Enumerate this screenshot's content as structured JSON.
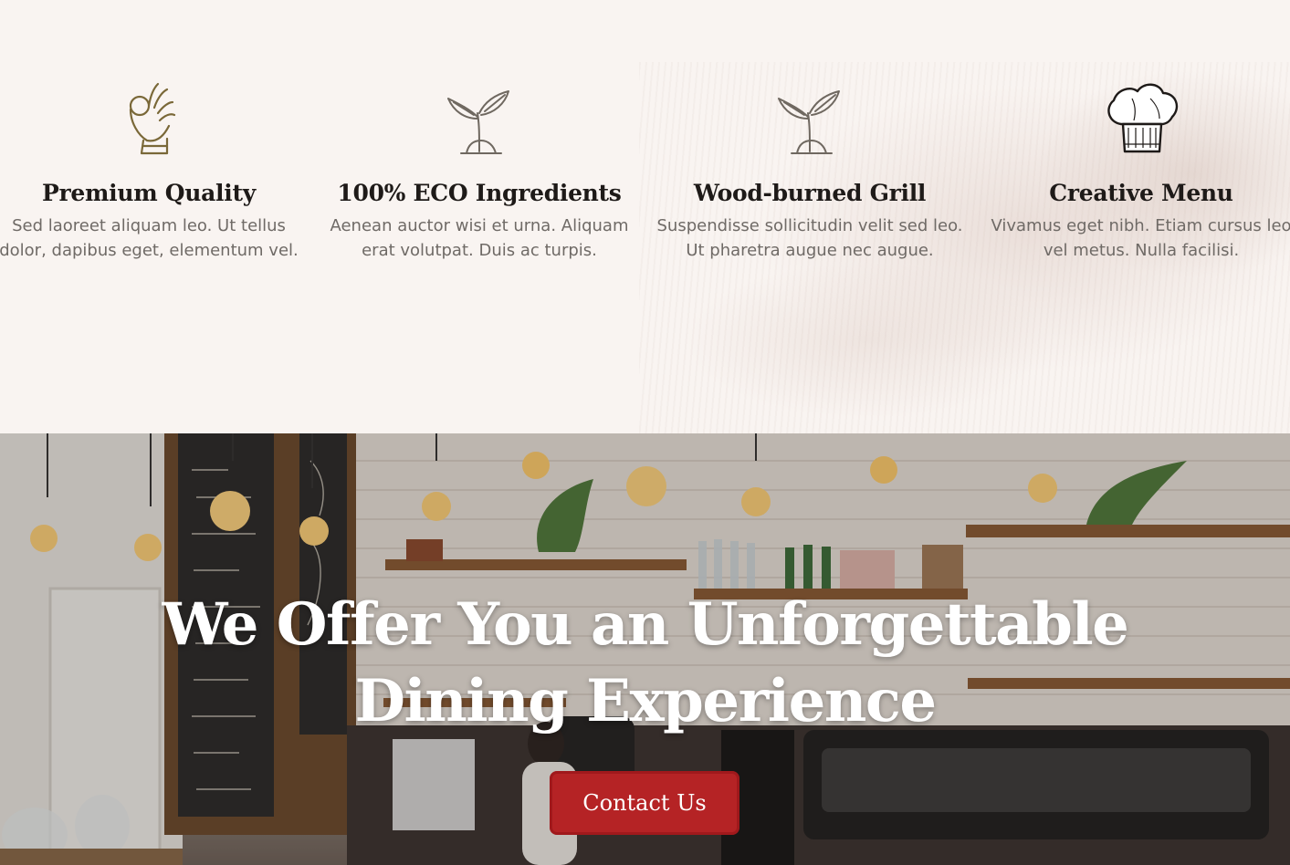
{
  "features": [
    {
      "icon": "ok-hand-icon",
      "title": "Premium Quality",
      "text": "Sed laoreet aliquam leo. Ut tellus dolor, dapibus eget, elementum vel."
    },
    {
      "icon": "sprout-icon",
      "title": "100% ECO Ingredients",
      "text": "Aenean auctor wisi et urna. Aliquam erat volutpat. Duis ac turpis."
    },
    {
      "icon": "sprout-icon",
      "title": "Wood-burned Grill",
      "text": "Suspendisse sollicitudin velit sed leo. Ut pharetra augue nec augue."
    },
    {
      "icon": "chef-hat-icon",
      "title": "Creative Menu",
      "text": "Vivamus eget nibh. Etiam cursus leo vel metus. Nulla facilisi."
    }
  ],
  "hero": {
    "heading": "We Offer You an Unforgettable Dining Experience",
    "cta_label": "Contact Us",
    "background": "cafe-interior-photo"
  },
  "colors": {
    "page_background": "#f9f4f1",
    "heading_text": "#1e1a18",
    "body_text": "#6f6a66",
    "icon_olive": "#7a6838",
    "cta_red": "#b52325"
  }
}
